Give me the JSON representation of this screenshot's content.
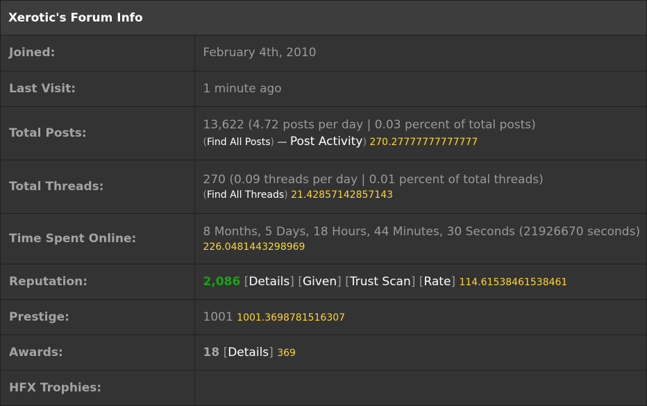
{
  "header": {
    "title": "Xerotic's Forum Info"
  },
  "rows": {
    "joined": {
      "label": "Joined:",
      "value": "February 4th, 2010"
    },
    "last_visit": {
      "label": "Last Visit:",
      "value": "1 minute ago"
    },
    "total_posts": {
      "label": "Total Posts:",
      "value": "13,622 (4.72 posts per day | 0.03 percent of total posts)",
      "find_link": "Find All Posts",
      "dash": "—",
      "activity_link": "Post Activity",
      "score": "270.27777777777777"
    },
    "total_threads": {
      "label": "Total Threads:",
      "value": "270 (0.09 threads per day | 0.01 percent of total threads)",
      "find_link": "Find All Threads",
      "score": "21.42857142857143"
    },
    "time_online": {
      "label": "Time Spent Online:",
      "value": "8 Months, 5 Days, 18 Hours, 44 Minutes, 30 Seconds (21926670 seconds)",
      "score": "226.0481443298969"
    },
    "reputation": {
      "label": "Reputation:",
      "value": "2,086",
      "details": "Details",
      "given": "Given",
      "trust_scan": "Trust Scan",
      "rate": "Rate",
      "score": "114.61538461538461"
    },
    "prestige": {
      "label": "Prestige:",
      "value": "1001",
      "score": "1001.3698781516307"
    },
    "awards": {
      "label": "Awards:",
      "value": "18",
      "details": "Details",
      "score": "369"
    },
    "hfx_trophies": {
      "label": "HFX Trophies:",
      "value": ""
    }
  },
  "colors": {
    "background": "#333333",
    "header_background": "#3d3d3d",
    "label_text": "#a3a3a3",
    "value_text": "#9a9a9a",
    "link_text": "#ffffff",
    "score_text": "#ffd633",
    "reputation_positive": "#16a516"
  }
}
